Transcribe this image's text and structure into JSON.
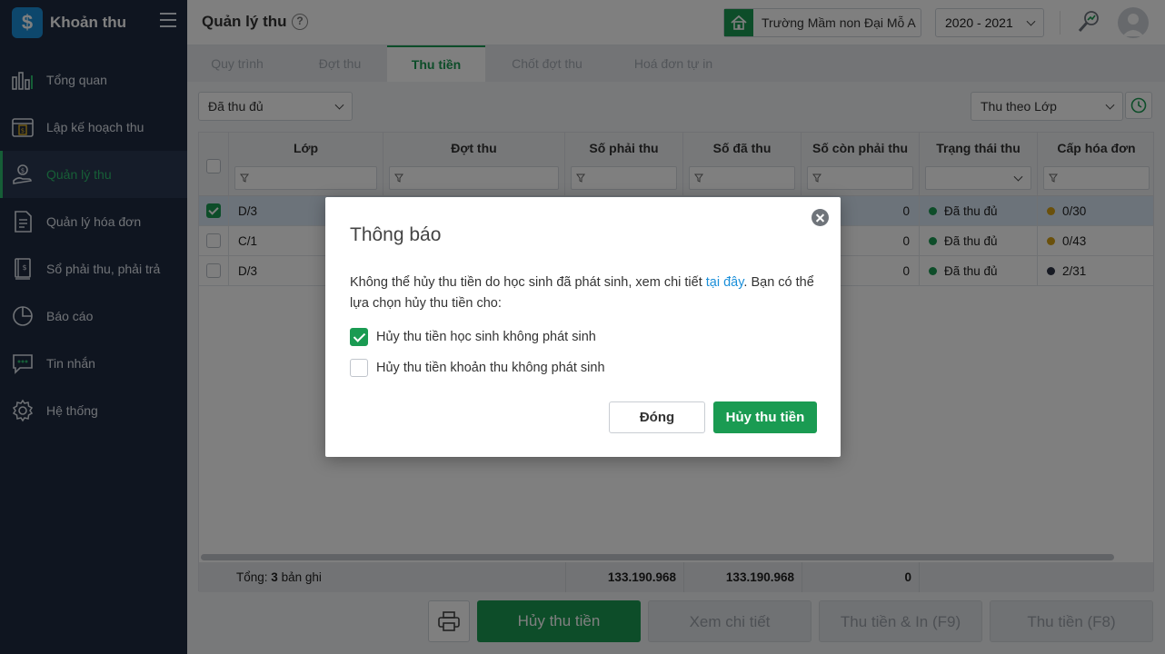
{
  "app": {
    "name": "Khoản thu"
  },
  "sidebar": {
    "items": [
      {
        "label": "Tổng quan",
        "icon": "bar-chart-icon"
      },
      {
        "label": "Lập kế hoạch thu",
        "icon": "calendar-money-icon"
      },
      {
        "label": "Quản lý thu",
        "icon": "hand-coin-icon",
        "active": true
      },
      {
        "label": "Quản lý hóa đơn",
        "icon": "document-icon"
      },
      {
        "label": "Sổ phải thu, phải trả",
        "icon": "ledger-icon"
      },
      {
        "label": "Báo cáo",
        "icon": "pie-chart-icon"
      },
      {
        "label": "Tin nhắn",
        "icon": "chat-icon"
      },
      {
        "label": "Hệ thống",
        "icon": "gear-icon"
      }
    ]
  },
  "header": {
    "title": "Quản lý thu",
    "school": "Trường Mầm non Đại Mỗ A",
    "year": "2020 - 2021"
  },
  "tabs": [
    {
      "label": "Quy trình"
    },
    {
      "label": "Đợt thu"
    },
    {
      "label": "Thu tiền",
      "active": true
    },
    {
      "label": "Chốt đợt thu"
    },
    {
      "label": "Hoá đơn tự in"
    }
  ],
  "filters": {
    "status": "Đã thu đủ",
    "group_by": "Thu theo Lớp"
  },
  "grid": {
    "columns": [
      "Lớp",
      "Đợt thu",
      "Số phải thu",
      "Số đã thu",
      "Số còn phải thu",
      "Trạng thái thu",
      "Cấp hóa đơn"
    ],
    "rows": [
      {
        "lop": "D/3",
        "con_phai_thu": "0",
        "trang_thai": "Đã thu đủ",
        "hoa_don": "0/30",
        "checked": true
      },
      {
        "lop": "C/1",
        "con_phai_thu": "0",
        "trang_thai": "Đã thu đủ",
        "hoa_don": "0/43",
        "checked": false
      },
      {
        "lop": "D/3",
        "con_phai_thu": "0",
        "trang_thai": "Đã thu đủ",
        "hoa_don": "2/31",
        "checked": false
      }
    ],
    "footer": {
      "total_label": "Tổng:",
      "total_count": "3",
      "total_unit": "bản ghi",
      "phai_thu": "133.190.968",
      "da_thu": "133.190.968",
      "con_phai_thu": "0"
    }
  },
  "actions": {
    "cancel": "Hủy thu tiền",
    "detail": "Xem chi tiết",
    "collect_print": "Thu tiền & In (F9)",
    "collect": "Thu tiền (F8)"
  },
  "modal": {
    "title": "Thông báo",
    "message_pre": "Không thể hủy thu tiền do học sinh đã phát sinh, xem chi tiết ",
    "message_link": "tại đây",
    "message_post": ". Bạn có thể lựa chọn hủy thu tiền cho:",
    "option1": "Hủy thu tiền học sinh không phát sinh",
    "option2": "Hủy thu tiền khoản thu không phát sinh",
    "close_btn": "Đóng",
    "confirm_btn": "Hủy thu tiền"
  },
  "colors": {
    "accent": "#1a9b52",
    "sidebar_bg": "#1f2a40",
    "status_green": "#1a9b52",
    "status_yellow": "#d4a017",
    "status_dark": "#2f3447"
  }
}
